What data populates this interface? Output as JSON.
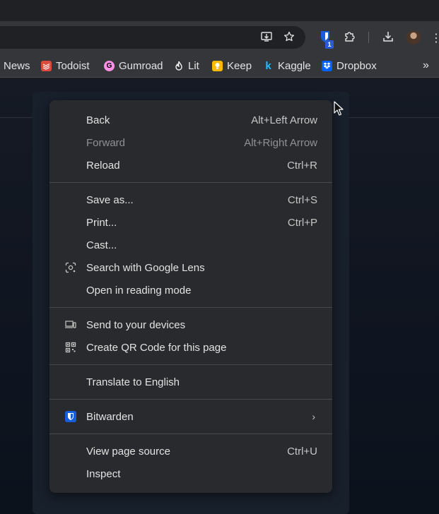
{
  "toolbar": {
    "icons": [
      "install-app-icon",
      "star-bookmark-icon",
      "bitwarden-extension-icon",
      "extensions-puzzle-icon",
      "download-icon",
      "profile-avatar",
      "menu-kebab-icon"
    ],
    "extension_badge": "1"
  },
  "bookmarks": [
    {
      "label": "News",
      "icon": "news-icon",
      "color": "#35363a"
    },
    {
      "label": "Todoist",
      "icon": "todoist-icon",
      "color": "#db4c3f"
    },
    {
      "label": "Gumroad",
      "icon": "gumroad-icon",
      "color": "#ff90e8"
    },
    {
      "label": "Lit",
      "icon": "lit-flame-icon",
      "color": "#ffffff"
    },
    {
      "label": "Keep",
      "icon": "keep-icon",
      "color": "#f9bb06"
    },
    {
      "label": "Kaggle",
      "icon": "kaggle-icon",
      "color": "#20beff"
    },
    {
      "label": "Dropbox",
      "icon": "dropbox-icon",
      "color": "#0061fe"
    }
  ],
  "context_menu": {
    "items": [
      {
        "label": "Back",
        "shortcut": "Alt+Left Arrow"
      },
      {
        "label": "Forward",
        "shortcut": "Alt+Right Arrow",
        "disabled": true
      },
      {
        "label": "Reload",
        "shortcut": "Ctrl+R"
      },
      {
        "label": "Save as...",
        "shortcut": "Ctrl+S"
      },
      {
        "label": "Print...",
        "shortcut": "Ctrl+P"
      },
      {
        "label": "Cast..."
      },
      {
        "label": "Search with Google Lens",
        "icon": "google-lens-icon"
      },
      {
        "label": "Open in reading mode"
      },
      {
        "label": "Send to your devices",
        "icon": "devices-icon"
      },
      {
        "label": "Create QR Code for this page",
        "icon": "qr-code-icon"
      },
      {
        "label": "Translate to English"
      },
      {
        "label": "Bitwarden",
        "icon": "bitwarden-icon",
        "submenu": true
      },
      {
        "label": "View page source",
        "shortcut": "Ctrl+U"
      },
      {
        "label": "Inspect"
      }
    ]
  }
}
